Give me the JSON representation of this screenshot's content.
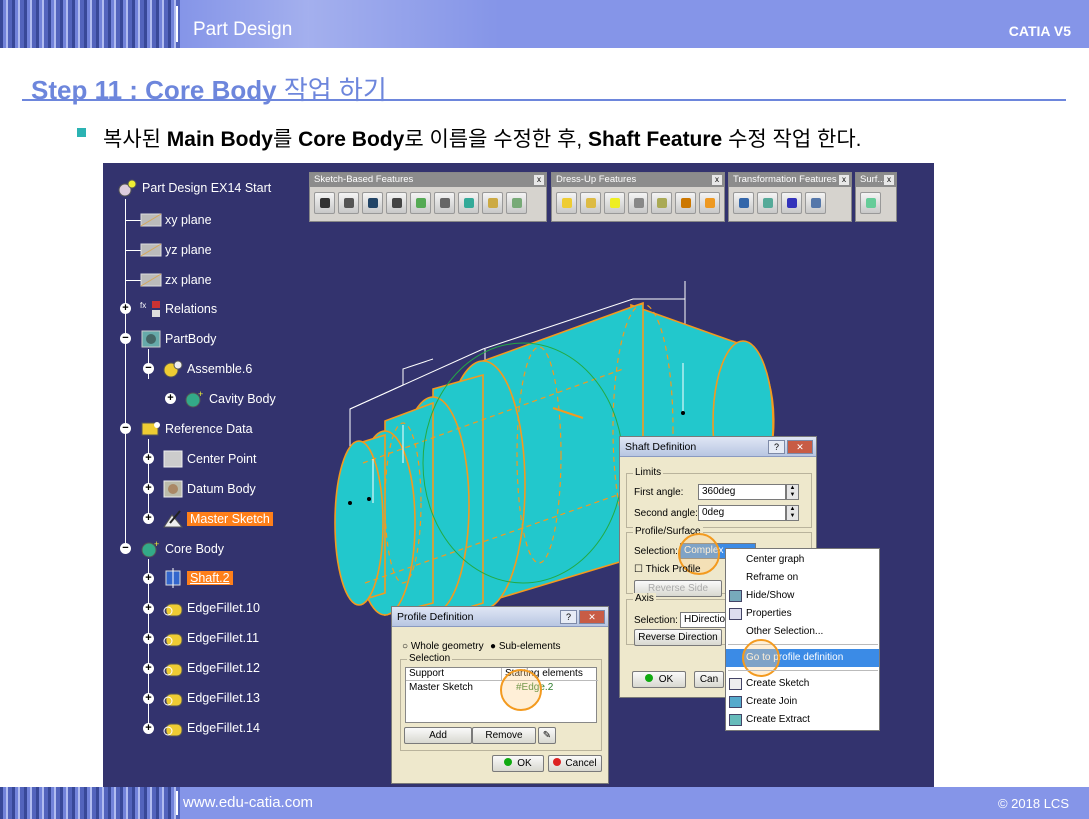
{
  "header": {
    "section": "Part Design",
    "product": "CATIA V5"
  },
  "footer": {
    "website": "www.edu-catia.com",
    "copyright": "© 2018 LCS"
  },
  "step": {
    "title_prefix": "Step 11 : Core Body",
    "title_suffix": "작업 하기"
  },
  "description": {
    "p1": "복사된 ",
    "b1": "Main Body",
    "p2": "를 ",
    "b2": "Core Body",
    "p3": "로 이름을 수정한 후, ",
    "b3": "Shaft Feature",
    "p4": " 수정 작업 한다."
  },
  "tree": {
    "root": "Part Design EX14 Start",
    "xy": "xy plane",
    "yz": "yz plane",
    "zx": "zx plane",
    "relations": "Relations",
    "partbody": "PartBody",
    "assemble": "Assemble.6",
    "cavity": "Cavity Body",
    "refdata": "Reference Data",
    "center_point": "Center Point",
    "datum_body": "Datum Body",
    "master_sketch": "Master Sketch",
    "core_body": "Core Body",
    "shaft": "Shaft.2",
    "f10": "EdgeFillet.10",
    "f11": "EdgeFillet.11",
    "f12": "EdgeFillet.12",
    "f13": "EdgeFillet.13",
    "f14": "EdgeFillet.14"
  },
  "toolbars": {
    "sketch": "Sketch-Based Features",
    "dressup": "Dress-Up Features",
    "transform": "Transformation Features",
    "surf": "Surf...",
    "close": "x"
  },
  "shaft_dialog": {
    "title": "Shaft Definition",
    "limits": "Limits",
    "first_label": "First angle:",
    "first_value": "360deg",
    "second_label": "Second angle:",
    "second_value": "0deg",
    "profile": "Profile/Surface",
    "selection_label": "Selection:",
    "selection_value": "Complex",
    "thick": "Thick Profile",
    "reverse_side": "Reverse Side",
    "axis": "Axis",
    "axis_label": "Selection:",
    "axis_value": "HDirection",
    "reverse_dir": "Reverse Direction",
    "ok": "OK",
    "cancel": "Can"
  },
  "profile_dialog": {
    "title": "Profile Definition",
    "whole": "Whole geometry",
    "sub": "Sub-elements",
    "selection": "Selection",
    "col_support": "Support",
    "col_start": "Starting elements",
    "row_support": "Master Sketch",
    "row_start": "#Edge.2",
    "add": "Add",
    "remove": "Remove",
    "ok": "OK",
    "cancel": "Cancel"
  },
  "context_menu": {
    "items": [
      "Center graph",
      "Reframe on",
      "Hide/Show",
      "Properties",
      "Other Selection...",
      "Go to profile definition",
      "Create Sketch",
      "Create Join",
      "Create Extract"
    ],
    "selected": "Go to profile definition"
  },
  "colors": {
    "accent": "#6d86dc",
    "bar": "#8595e8",
    "viewport": "#33336e",
    "highlight": "#ff7f1a",
    "shaft": "#22c8cc",
    "edge": "#f39a1f"
  }
}
